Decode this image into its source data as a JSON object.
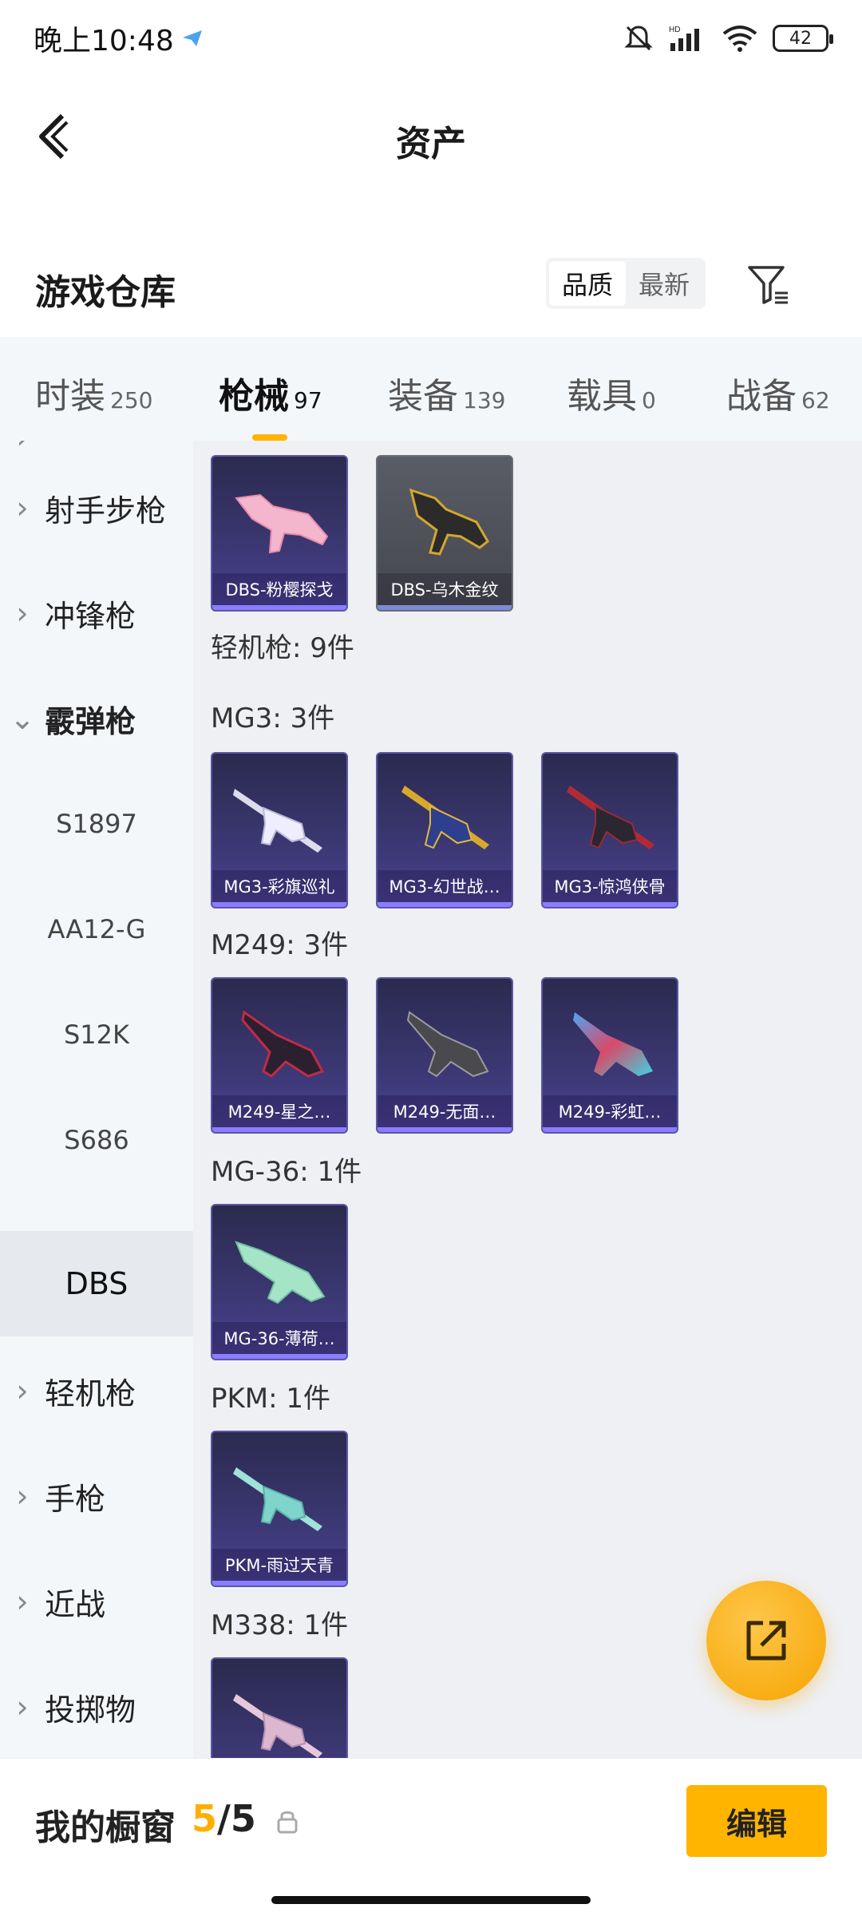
{
  "status_bar": {
    "time": "晚上10:48",
    "battery": "42"
  },
  "header": {
    "title": "资产"
  },
  "warehouse": {
    "title": "游戏仓库",
    "sort_options": [
      "品质",
      "最新"
    ],
    "active_sort": "品质"
  },
  "tabs": [
    {
      "label": "时装",
      "count": "250"
    },
    {
      "label": "枪械",
      "count": "97",
      "active": true
    },
    {
      "label": "装备",
      "count": "139"
    },
    {
      "label": "载具",
      "count": "0"
    },
    {
      "label": "战备",
      "count": "62"
    }
  ],
  "sidebar": {
    "items": [
      {
        "label": "射手步枪"
      },
      {
        "label": "冲锋枪"
      },
      {
        "label": "霰弹枪",
        "expanded": true
      },
      {
        "label": "S1897"
      },
      {
        "label": "AA12-G"
      },
      {
        "label": "S12K"
      },
      {
        "label": "S686"
      },
      {
        "label": "DBS",
        "selected": true
      },
      {
        "label": "轻机枪"
      },
      {
        "label": "手枪"
      },
      {
        "label": "近战"
      },
      {
        "label": "投掷物"
      }
    ]
  },
  "main": {
    "dbs_cards": [
      "DBS-粉樱探戈",
      "DBS-乌木金纹"
    ],
    "lmg_total": "轻机枪: 9件",
    "groups": [
      {
        "label": "MG3: 3件",
        "cards": [
          "MG3-彩旗巡礼",
          "MG3-幻世战…",
          "MG3-惊鸿侠骨"
        ]
      },
      {
        "label": "M249: 3件",
        "cards": [
          "M249-星之…",
          "M249-无面…",
          "M249-彩虹…"
        ]
      },
      {
        "label": "MG-36: 1件",
        "cards": [
          "MG-36-薄荷…"
        ]
      },
      {
        "label": "PKM: 1件",
        "cards": [
          "PKM-雨过天青"
        ]
      },
      {
        "label": "M338: 1件",
        "cards": [
          ""
        ]
      }
    ]
  },
  "bottom_bar": {
    "window_label": "我的橱窗",
    "current": "5",
    "slash": "/",
    "total": "5",
    "edit_label": "编辑"
  },
  "colors": {
    "accent": "#ffb400",
    "card_purple": "#3f3a7a",
    "sidebar_bg": "#f4f7fa",
    "main_bg": "#eef0f3"
  }
}
